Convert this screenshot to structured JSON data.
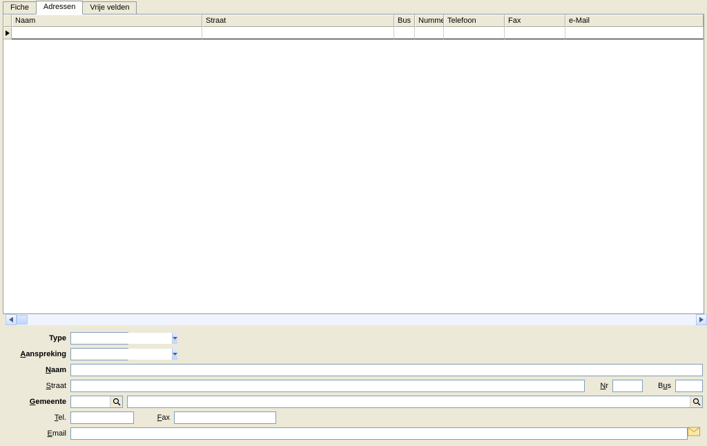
{
  "tabs": {
    "t0": "Fiche",
    "t1": "Adressen",
    "t2": "Vrije velden"
  },
  "columns": {
    "naam": "Naam",
    "straat": "Straat",
    "bus": "Bus",
    "nummer": "Nummer",
    "telefoon": "Telefoon",
    "fax": "Fax",
    "email": "e-Mail"
  },
  "labels": {
    "type": "Type",
    "aanspreking_pre": "A",
    "aanspreking_post": "anspreking",
    "naam_pre": "N",
    "naam_post": "aam",
    "straat_pre": "S",
    "straat_post": "traat",
    "nr_pre": "N",
    "nr_post": "r",
    "bus_pre": "u",
    "bus_beforeU": "B",
    "bus_post": "s",
    "gemeente_pre": "G",
    "gemeente_post": "emeente",
    "tel_pre": "T",
    "tel_post": "el.",
    "fax_pre": "F",
    "fax_post": "ax",
    "email_pre": "E",
    "email_post": "mail"
  },
  "values": {
    "type": "",
    "aanspreking": "",
    "naam": "",
    "straat": "",
    "nr": "",
    "bus": "",
    "gemeente_code": "",
    "gemeente_name": "",
    "tel": "",
    "fax": "",
    "email": ""
  }
}
